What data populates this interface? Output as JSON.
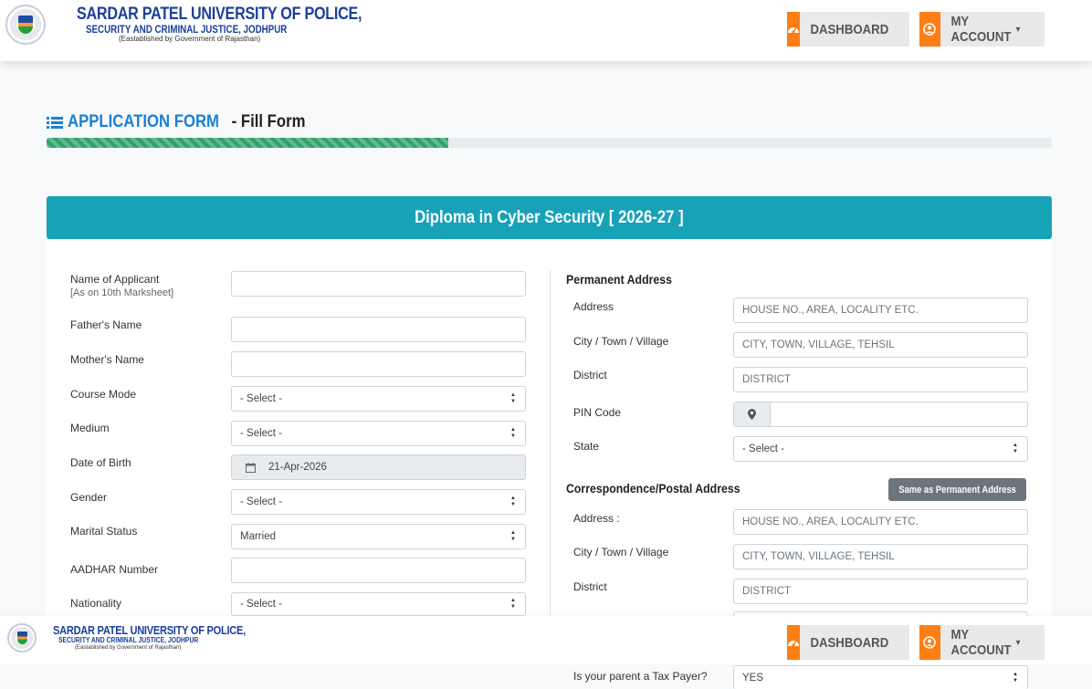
{
  "header": {
    "university_title": "SARDAR PATEL UNIVERSITY OF POLICE,",
    "university_sub": "SECURITY AND CRIMINAL JUSTICE, JODHPUR",
    "established": "(Eastablished by Government of Rajasthan)",
    "dashboard_label": "DASHBOARD",
    "account_label": "MY ACCOUNT",
    "dashboard_icon": "dashboard-gauge-icon",
    "account_icon": "user-circle-icon"
  },
  "page": {
    "heading_highlight": "APPLICATION FORM",
    "heading_rest": "- Fill Form",
    "progress_percent": 40
  },
  "card": {
    "title": "Diploma in Cyber Security [ 2026-27 ]"
  },
  "left_form": {
    "name_label": "Name of Applicant",
    "name_note": "[As on 10th Marksheet]",
    "father_label": "Father's Name",
    "mother_label": "Mother's Name",
    "course_mode_label": "Course Mode",
    "course_mode_value": "- Select -",
    "medium_label": "Medium",
    "medium_value": "- Select -",
    "dob_label": "Date of Birth",
    "dob_value": "21-Apr-2026",
    "gender_label": "Gender",
    "gender_value": "- Select -",
    "marital_label": "Marital Status",
    "marital_value": "Married",
    "aadhar_label": "AADHAR Number",
    "nationality_label": "Nationality",
    "nationality_value": "- Select -"
  },
  "permanent": {
    "title": "Permanent Address",
    "address_label": "Address",
    "address_placeholder": "HOUSE NO., AREA, LOCALITY ETC.",
    "city_label": "City / Town / Village",
    "city_placeholder": "CITY, TOWN, VILLAGE, TEHSIL",
    "district_label": "District",
    "district_placeholder": "DISTRICT",
    "pin_label": "PIN Code",
    "state_label": "State",
    "state_value": "- Select -"
  },
  "correspondence": {
    "title": "Correspondence/Postal Address",
    "same_button": "Same as Permanent Address",
    "address_label": "Address :",
    "address_placeholder": "HOUSE NO., AREA, LOCALITY ETC.",
    "city_label": "City / Town / Village",
    "city_placeholder": "CITY, TOWN, VILLAGE, TEHSIL",
    "district_label": "District",
    "district_placeholder": "DISTRICT"
  },
  "tax": {
    "label": "Is your parent a Tax Payer?",
    "value": "YES"
  }
}
